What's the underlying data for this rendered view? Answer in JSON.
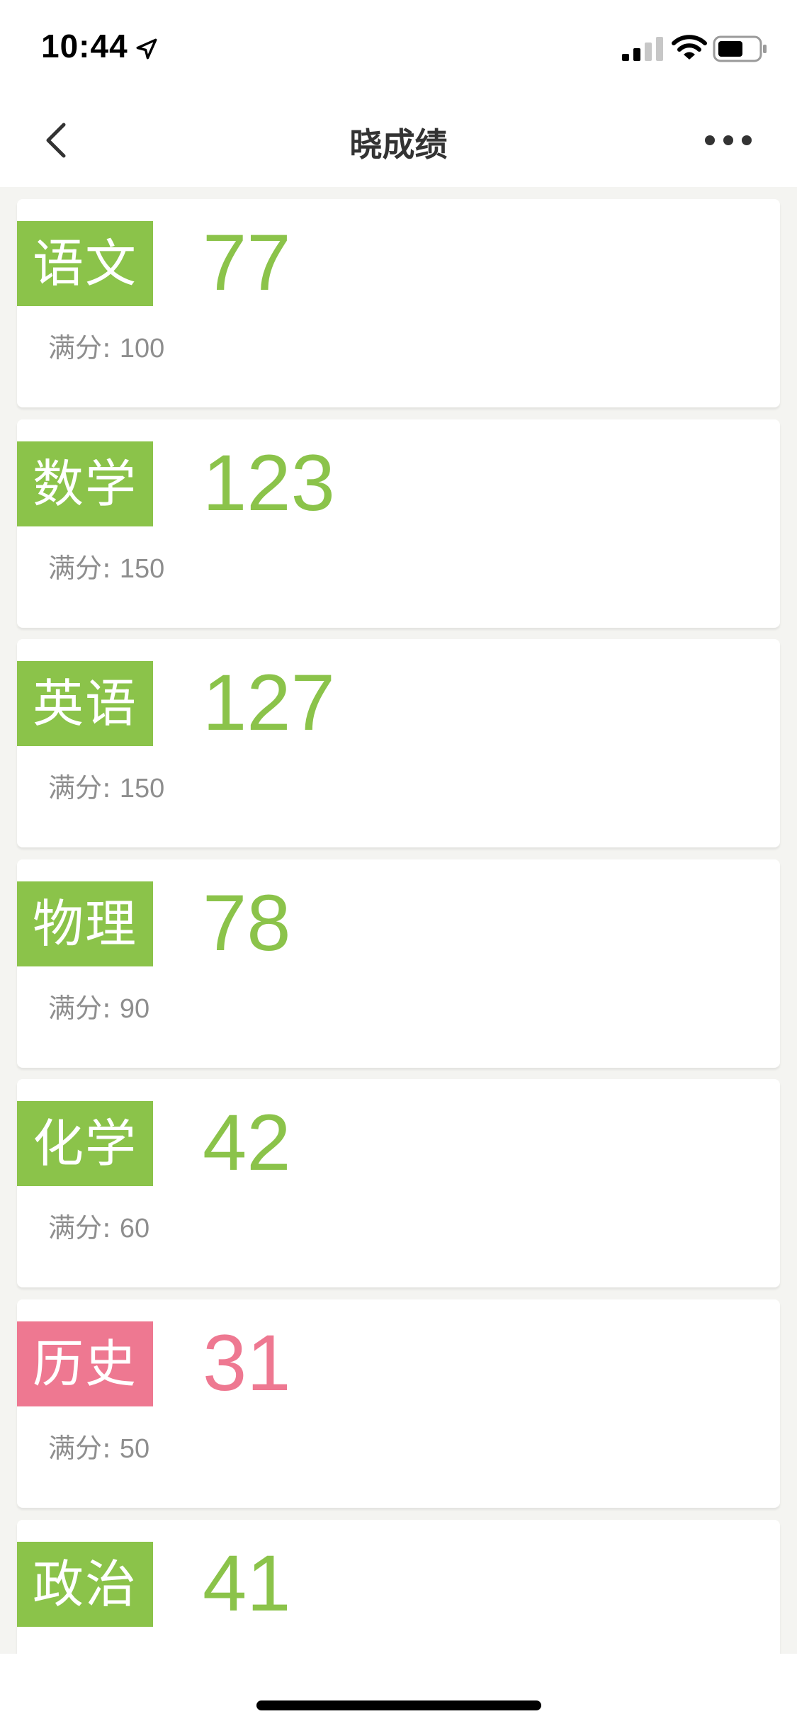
{
  "status_bar": {
    "time": "10:44",
    "icons": [
      "location-arrow-icon",
      "cellular-signal-icon",
      "wifi-icon",
      "battery-icon"
    ]
  },
  "nav": {
    "title": "晓成绩",
    "back_icon": "chevron-left-icon",
    "more_icon": "more-dots-icon"
  },
  "labels": {
    "full_score_prefix": "满分: "
  },
  "colors": {
    "pass": "#8bc34a",
    "fail": "#ee7891",
    "muted_text": "#8e8e8e",
    "background": "#f4f4f1"
  },
  "subjects": [
    {
      "name": "语文",
      "score": "77",
      "full": "100",
      "status": "pass"
    },
    {
      "name": "数学",
      "score": "123",
      "full": "150",
      "status": "pass"
    },
    {
      "name": "英语",
      "score": "127",
      "full": "150",
      "status": "pass"
    },
    {
      "name": "物理",
      "score": "78",
      "full": "90",
      "status": "pass"
    },
    {
      "name": "化学",
      "score": "42",
      "full": "60",
      "status": "pass"
    },
    {
      "name": "历史",
      "score": "31",
      "full": "50",
      "status": "fail"
    },
    {
      "name": "政治",
      "score": "41",
      "full": "",
      "status": "pass"
    }
  ]
}
